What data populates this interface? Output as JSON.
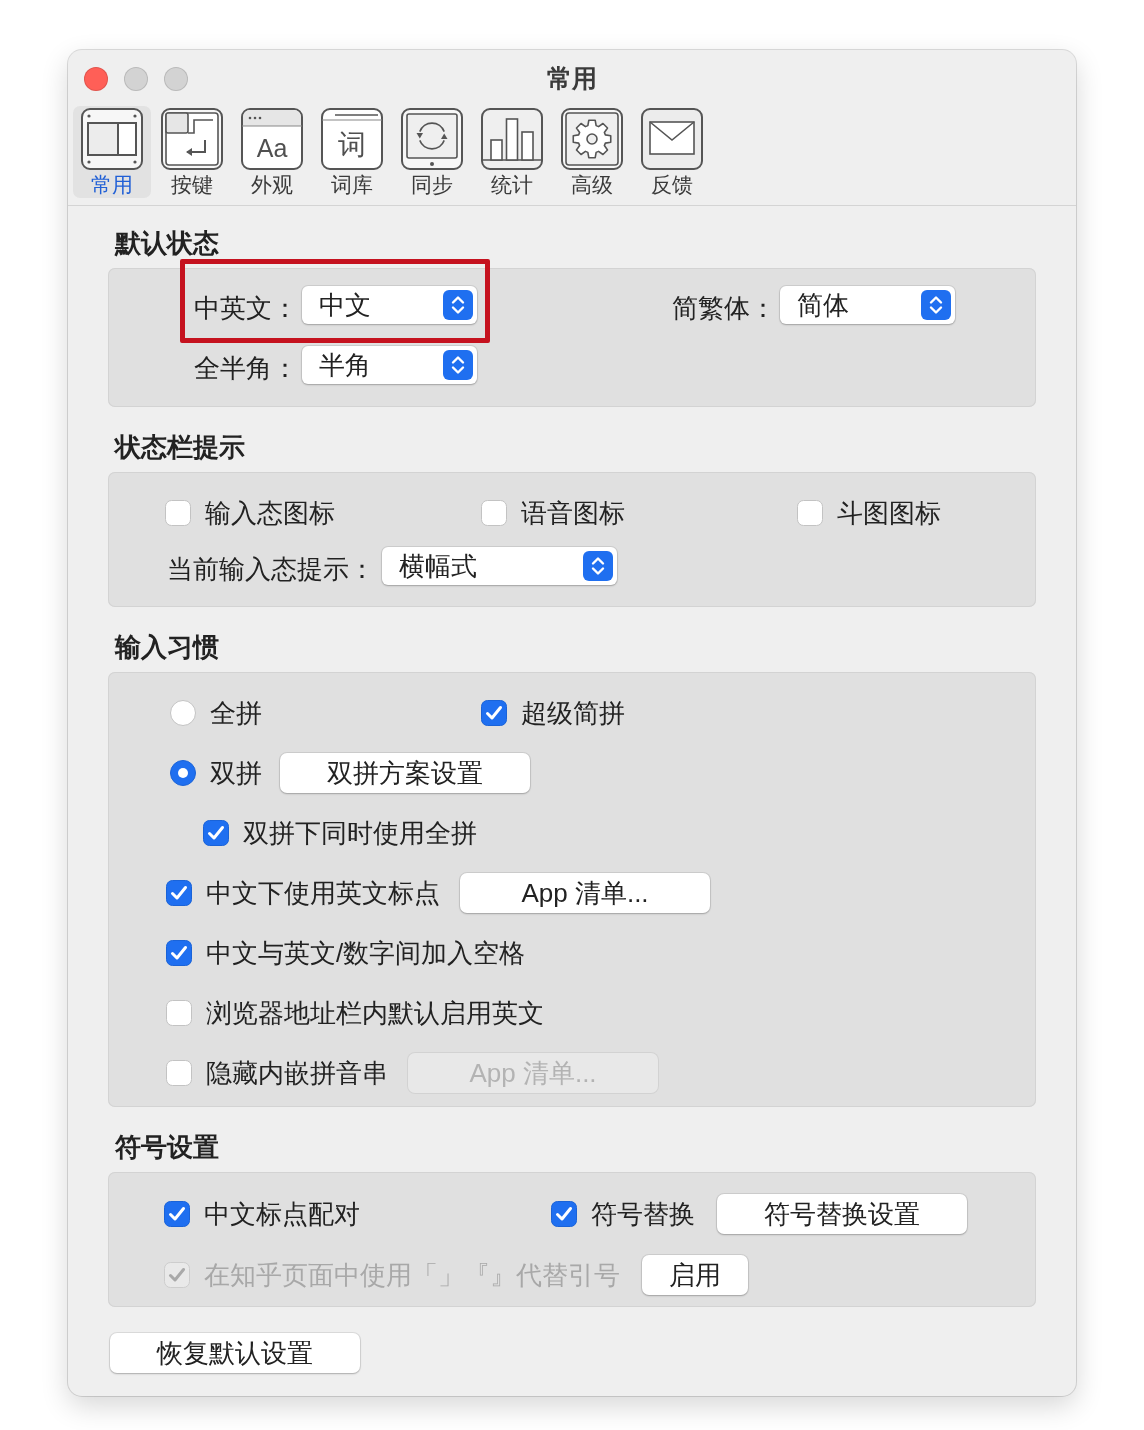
{
  "window": {
    "title": "常用",
    "buttons": [
      {
        "kind": "close",
        "disabled": false
      },
      {
        "kind": "minimize",
        "disabled": true
      },
      {
        "kind": "zoom",
        "disabled": true
      }
    ]
  },
  "toolbar": [
    {
      "label": "常用",
      "kind": "panes",
      "selected": true
    },
    {
      "label": "按键",
      "kind": "keys",
      "selected": false
    },
    {
      "label": "外观",
      "kind": "font",
      "icon_text": "Aa",
      "selected": false
    },
    {
      "label": "词库",
      "kind": "page",
      "icon_text": "词",
      "selected": false
    },
    {
      "label": "同步",
      "kind": "sync",
      "selected": false
    },
    {
      "label": "统计",
      "kind": "bars",
      "selected": false
    },
    {
      "label": "高级",
      "kind": "gear",
      "selected": false
    },
    {
      "label": "反馈",
      "kind": "mail",
      "selected": false
    }
  ],
  "sections": [
    {
      "title": "默认状态",
      "rows": [
        {
          "items": [
            {
              "kind": "popup",
              "label": "中英文：",
              "value": "中文",
              "highlighted": true
            },
            {
              "kind": "popup",
              "label": "简繁体：",
              "value": "简体"
            }
          ]
        },
        {
          "items": [
            {
              "kind": "popup",
              "label": "全半角：",
              "value": "半角"
            }
          ]
        }
      ]
    },
    {
      "title": "状态栏提示",
      "rows": [
        {
          "items": [
            {
              "kind": "checkbox",
              "label": "输入态图标",
              "checked": false,
              "disabled": false
            },
            {
              "kind": "checkbox",
              "label": "语音图标",
              "checked": false,
              "disabled": false
            },
            {
              "kind": "checkbox",
              "label": "斗图图标",
              "checked": false,
              "disabled": false
            }
          ]
        },
        {
          "items": [
            {
              "kind": "popup",
              "label": "当前输入态提示：",
              "value": "横幅式"
            }
          ]
        }
      ]
    },
    {
      "title": "输入习惯",
      "rows": [
        {
          "items": [
            {
              "kind": "radio",
              "label": "全拼",
              "selected": false
            },
            {
              "kind": "checkbox",
              "label": "超级简拼",
              "checked": true,
              "disabled": false
            }
          ]
        },
        {
          "items": [
            {
              "kind": "radio",
              "label": "双拼",
              "selected": true
            },
            {
              "kind": "button",
              "label": "双拼方案设置",
              "disabled": false
            }
          ],
          "children": [
            {
              "items": [
                {
                  "kind": "checkbox",
                  "label": "双拼下同时使用全拼",
                  "checked": true,
                  "disabled": false
                }
              ]
            }
          ]
        },
        {
          "items": [
            {
              "kind": "checkbox",
              "label": "中文下使用英文标点",
              "checked": true,
              "disabled": false
            },
            {
              "kind": "button",
              "label": "App 清单...",
              "disabled": false
            }
          ]
        },
        {
          "items": [
            {
              "kind": "checkbox",
              "label": "中文与英文/数字间加入空格",
              "checked": true,
              "disabled": false
            }
          ]
        },
        {
          "items": [
            {
              "kind": "checkbox",
              "label": "浏览器地址栏内默认启用英文",
              "checked": false,
              "disabled": false
            }
          ]
        },
        {
          "items": [
            {
              "kind": "checkbox",
              "label": "隐藏内嵌拼音串",
              "checked": false,
              "disabled": false
            },
            {
              "kind": "button",
              "label": "App 清单...",
              "disabled": true
            }
          ]
        }
      ]
    },
    {
      "title": "符号设置",
      "rows": [
        {
          "items": [
            {
              "kind": "checkbox",
              "label": "中文标点配对",
              "checked": true,
              "disabled": false
            },
            {
              "kind": "checkbox",
              "label": "符号替换",
              "checked": true,
              "disabled": false
            },
            {
              "kind": "button",
              "label": "符号替换设置",
              "disabled": false
            }
          ]
        },
        {
          "items": [
            {
              "kind": "checkbox",
              "label": "在知乎页面中使用「」『』代替引号",
              "checked": true,
              "disabled": true
            },
            {
              "kind": "button",
              "label": "启用",
              "disabled": false
            }
          ]
        }
      ]
    }
  ],
  "reset_button": {
    "label": "恢复默认设置"
  }
}
